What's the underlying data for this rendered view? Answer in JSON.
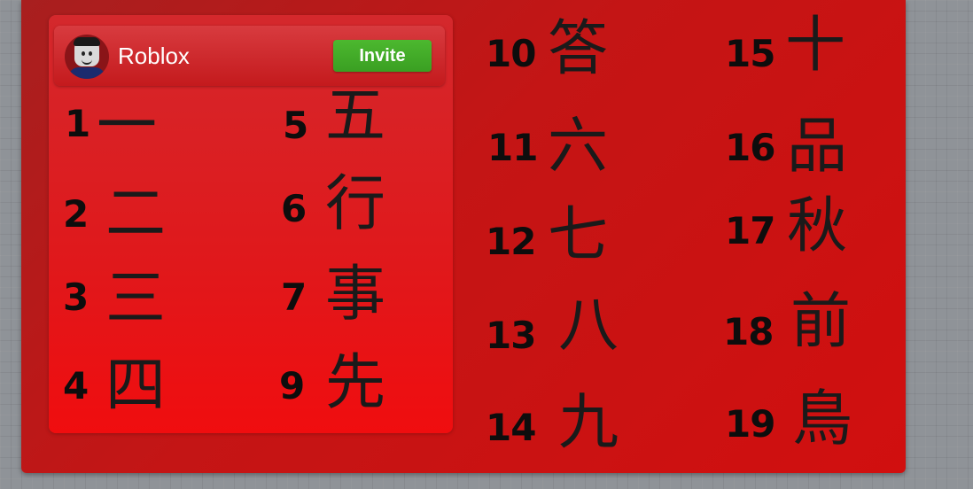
{
  "header": {
    "username": "Roblox",
    "invite_label": "Invite"
  },
  "entries": [
    {
      "number": "1",
      "char": "一"
    },
    {
      "number": "2",
      "char": "二"
    },
    {
      "number": "3",
      "char": "三"
    },
    {
      "number": "4",
      "char": "四"
    },
    {
      "number": "5",
      "char": "五"
    },
    {
      "number": "6",
      "char": "行"
    },
    {
      "number": "7",
      "char": "事"
    },
    {
      "number": "9",
      "char": "先"
    },
    {
      "number": "10",
      "char": "答"
    },
    {
      "number": "11",
      "char": "六"
    },
    {
      "number": "12",
      "char": "七"
    },
    {
      "number": "13",
      "char": "八"
    },
    {
      "number": "14",
      "char": "九"
    },
    {
      "number": "15",
      "char": "十"
    },
    {
      "number": "16",
      "char": "品"
    },
    {
      "number": "17",
      "char": "秋"
    },
    {
      "number": "18",
      "char": "前"
    },
    {
      "number": "19",
      "char": "鳥"
    }
  ],
  "colors": {
    "board": "#c41515",
    "invite_button": "#3fa826",
    "text": "#0d0d0d"
  }
}
